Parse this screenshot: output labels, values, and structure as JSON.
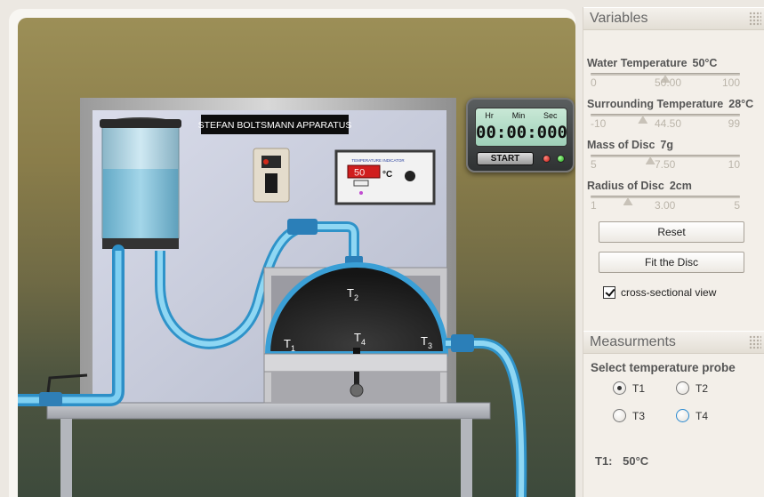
{
  "apparatus": {
    "title": "STEFAN BOLTSMANN APPARATUS",
    "indicator_brand": "TEMPERATURE INDICATOR",
    "indicator_value": "50",
    "indicator_unit": "°C",
    "probe_labels": [
      {
        "main": "T",
        "sub": "1"
      },
      {
        "main": "T",
        "sub": "2"
      },
      {
        "main": "T",
        "sub": "3"
      },
      {
        "main": "T",
        "sub": "4"
      }
    ]
  },
  "timer": {
    "labels": [
      "Hr",
      "Min",
      "Sec"
    ],
    "display": "00:00:000",
    "start_label": "START"
  },
  "variables": {
    "header": "Variables",
    "items": [
      {
        "label": "Water Temperature",
        "value": "50°C",
        "min": "0",
        "current": "50.00",
        "max": "100",
        "fraction": 0.5
      },
      {
        "label": "Surrounding Temperature",
        "value": "28°C",
        "min": "-10",
        "current": "44.50",
        "max": "99",
        "fraction": 0.35
      },
      {
        "label": "Mass of Disc",
        "value": "7g",
        "min": "5",
        "current": "7.50",
        "max": "10",
        "fraction": 0.4
      },
      {
        "label": "Radius of Disc",
        "value": "2cm",
        "min": "1",
        "current": "3.00",
        "max": "5",
        "fraction": 0.25
      }
    ],
    "reset_label": "Reset",
    "fit_label": "Fit the Disc",
    "cross_section_label": "cross-sectional view",
    "cross_section_checked": true
  },
  "measurements": {
    "header": "Measurments",
    "probe_title": "Select temperature probe",
    "probes": [
      {
        "label": "T1",
        "checked": true
      },
      {
        "label": "T2",
        "checked": false
      },
      {
        "label": "T3",
        "checked": false
      },
      {
        "label": "T4",
        "checked": false
      }
    ],
    "readout_label": "T1:",
    "readout_value": "50°C"
  },
  "colors": {
    "water": "#4fb3e6",
    "pipe": "#7cc8ec",
    "panel_bg": "#f3efe9"
  }
}
